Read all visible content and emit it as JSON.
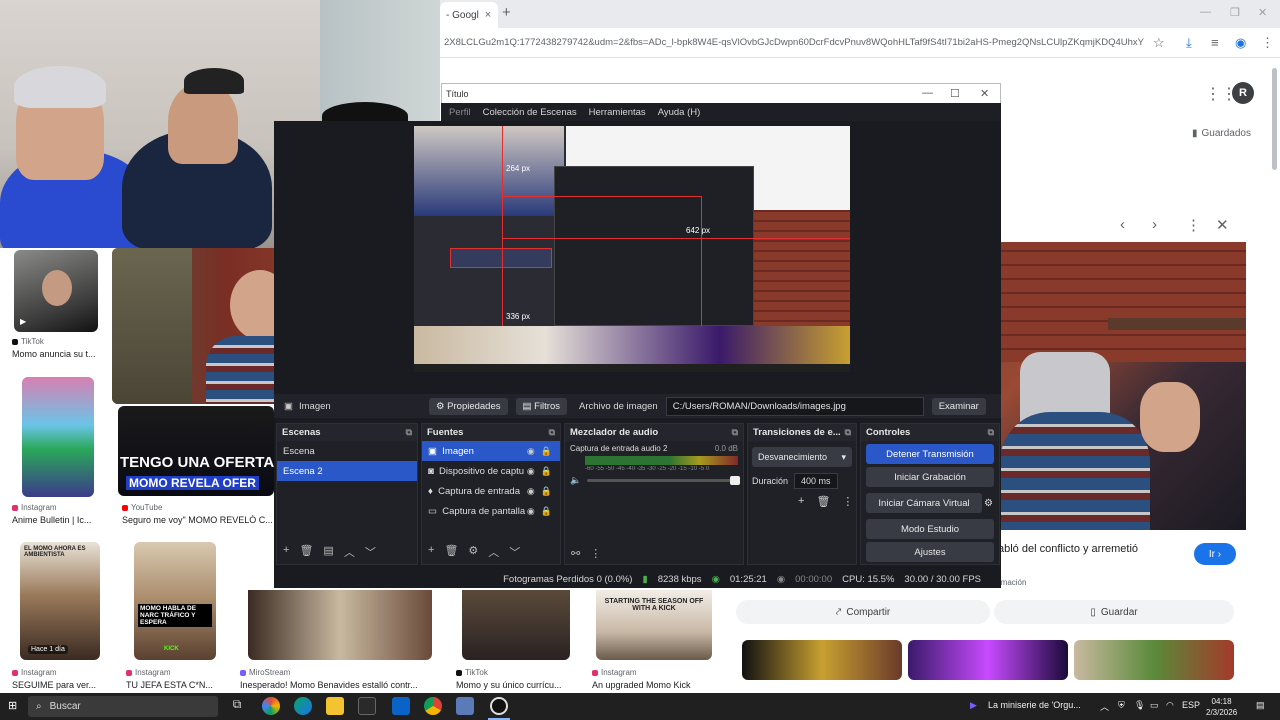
{
  "chrome": {
    "tab_title": "- Googl",
    "tab_close": "×",
    "new_tab": "+",
    "url": "2X8LCLGu2m1Q:1772438279742&udm=2&fbs=ADc_l-bpk8W4E-qsVlOvbGJcDwpn60DcrFdcvPnuv8WQohHLTaf9fS4tI71bi2aHS-Pmeg2QNsLCUlpZKqmjKDQ4UhxYCTgA...",
    "saved_label": "Guardados",
    "profile_initial": "R"
  },
  "results": [
    {
      "source": "TikTok",
      "title": "Momo anuncia su t...",
      "color": "#111111"
    },
    {
      "source": "Instagram",
      "title": "Anime Bulletin | Ic...",
      "color": "#e1306c"
    },
    {
      "source": "YouTube",
      "title": "Seguro me voy\" MOMO REVELÓ C...",
      "color": "#ff0000"
    },
    {
      "source": "Instagram",
      "title": "SEGUIME para ver...",
      "color": "#e1306c"
    },
    {
      "source": "Instagram",
      "title": "TU JEFA ESTA C*N...",
      "color": "#e1306c"
    },
    {
      "source": "MiroStream",
      "title": "Inesperado! Momo Benavides estalló contr...",
      "color": "#7b5cff"
    },
    {
      "source": "TikTok",
      "title": "Momo y su único currícu...",
      "color": "#111111"
    },
    {
      "source": "Instagram",
      "title": "An upgraded Momo Kick",
      "color": "#e1306c"
    }
  ],
  "thumb_texts": {
    "offer_headline": "TENGO UNA OFERTA DE",
    "offer_sub": "MOMO REVELA OFER",
    "badge_time": "Hace 1 día",
    "momo_ahora": "EL MOMO AHORA ES AMBIENTISTA",
    "momo_habla": "MOMO HABLA DE NARC TRÁFICO Y ESPERA",
    "kick": "KICK",
    "season": "STARTING THE SEASON OFF WITH A KICK"
  },
  "preview": {
    "title": "abló del conflicto y arremetió",
    "source_line": "rmación",
    "visit_label": "Ir",
    "share_label": "Compartir",
    "save_label": "Guardar"
  },
  "obs": {
    "title": "Título",
    "menu": [
      "Perfil",
      "Colección de Escenas",
      "Herramientas",
      "Ayuda (H)"
    ],
    "selected_source_label": "Imagen",
    "properties_label": "Propiedades",
    "filters_label": "Filtros",
    "image_file_label": "Archivo de imagen",
    "image_path": "C:/Users/ROMAN/Downloads/images.jpg",
    "browse_label": "Examinar",
    "preview_px": {
      "top": "264 px",
      "right": "642 px",
      "bottom": "336 px"
    },
    "docks": {
      "scenes": {
        "title": "Escenas",
        "items": [
          "Escena",
          "Escena 2"
        ]
      },
      "sources": {
        "title": "Fuentes",
        "items": [
          "Imagen",
          "Dispositivo de captu",
          "Captura de entrada",
          "Captura de pantalla"
        ]
      },
      "mixer": {
        "title": "Mezclador de audio",
        "channel": "Captura de entrada audio 2",
        "level": "0.0 dB",
        "scale": "-60 -55 -50 -45 -40 -35 -30 -25 -20 -15 -10 -5 0"
      },
      "transitions": {
        "title": "Transiciones de e...",
        "type": "Desvanecimiento",
        "duration_label": "Duración",
        "duration_value": "400 ms"
      },
      "controls": {
        "title": "Controles",
        "buttons": [
          "Detener Transmisión",
          "Iniciar Grabación",
          "Iniciar Cámara Virtual",
          "Modo Estudio",
          "Ajustes"
        ]
      }
    },
    "status": {
      "dropped": "Fotogramas Perdidos 0 (0.0%)",
      "bitrate": "8238 kbps",
      "stream_time": "01:25:21",
      "rec_time": "00:00:00",
      "cpu": "CPU: 15.5%",
      "fps": "30.00 / 30.00 FPS"
    }
  },
  "taskbar": {
    "search": "Buscar",
    "media": "La miniserie de 'Orgu...",
    "lang": "ESP",
    "time": "04:18",
    "date": "2/3/2026"
  }
}
